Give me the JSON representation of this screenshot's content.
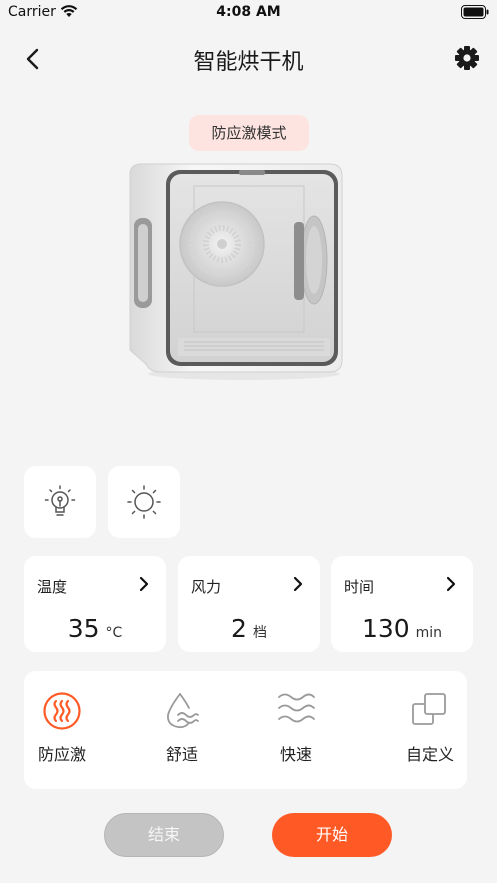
{
  "status_bar": {
    "carrier": "Carrier",
    "time": "4:08 AM"
  },
  "nav": {
    "title": "智能烘干机"
  },
  "mode_tag": "防应激模式",
  "params": [
    {
      "label": "温度",
      "value": "35",
      "unit": "°C"
    },
    {
      "label": "风力",
      "value": "2",
      "unit": "档"
    },
    {
      "label": "时间",
      "value": "130",
      "unit": "min"
    }
  ],
  "modes": [
    {
      "label": "防应激",
      "icon": "steam-icon",
      "active": true
    },
    {
      "label": "舒适",
      "icon": "water-drop-icon",
      "active": false
    },
    {
      "label": "快速",
      "icon": "wind-waves-icon",
      "active": false
    },
    {
      "label": "自定义",
      "icon": "custom-squares-icon",
      "active": false
    }
  ],
  "buttons": {
    "end": "结束",
    "start": "开始"
  },
  "colors": {
    "accent": "#ff5a26",
    "tag_bg": "#fde4e0",
    "inactive_icon": "#9a9a9a",
    "background": "#f4f4f4"
  }
}
